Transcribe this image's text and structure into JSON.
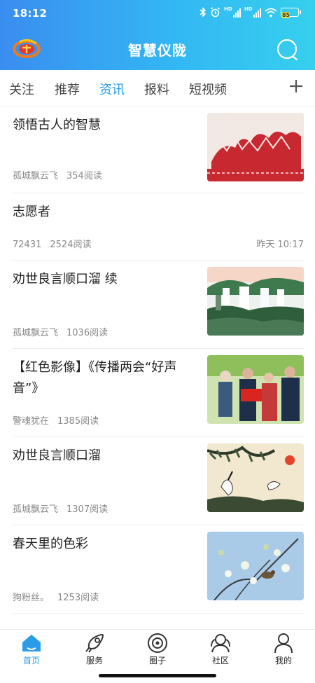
{
  "status": {
    "time": "18:12",
    "battery": "85",
    "signal_label": "HD"
  },
  "header": {
    "title": "智慧仪陇",
    "logo_icon": "app-logo-icon",
    "search_icon": "search-icon"
  },
  "tabs": [
    {
      "label": "关注",
      "active": false
    },
    {
      "label": "推荐",
      "active": false
    },
    {
      "label": "资讯",
      "active": true
    },
    {
      "label": "报料",
      "active": false
    },
    {
      "label": "短视频",
      "active": false
    }
  ],
  "tab_add_icon": "plus-icon",
  "articles": [
    {
      "title": "领悟古人的智慧",
      "author": "孤城飘云飞",
      "reads": "354阅读",
      "image": "red-papercut-horses"
    },
    {
      "title": "志愿者",
      "author": "72431",
      "reads": "2524阅读",
      "time": "昨天 10:17"
    },
    {
      "title": "劝世良言顺口溜 续",
      "author": "孤城飘云飞",
      "reads": "1036阅读",
      "image": "waterfall-painting"
    },
    {
      "title": "【红色影像】《传播两会“好声音”》",
      "author": "警魂犹在",
      "reads": "1385阅读",
      "image": "police-with-elders-photo"
    },
    {
      "title": "劝世良言顺口溜",
      "author": "孤城飘云飞",
      "reads": "1307阅读",
      "image": "cranes-pine-painting"
    },
    {
      "title": "春天里的色彩",
      "author": "狗粉丝。",
      "reads": "1253阅读",
      "image": "spring-blossom-bird-photo"
    }
  ],
  "bottom_nav": [
    {
      "label": "首页",
      "icon": "home-icon",
      "active": true
    },
    {
      "label": "服务",
      "icon": "rocket-icon",
      "active": false
    },
    {
      "label": "圈子",
      "icon": "circle-icon",
      "active": false
    },
    {
      "label": "社区",
      "icon": "community-icon",
      "active": false
    },
    {
      "label": "我的",
      "icon": "profile-icon",
      "active": false
    }
  ],
  "colors": {
    "accent": "#2a9ce8",
    "header_start": "#3a8df0",
    "header_end": "#36d0ee"
  }
}
